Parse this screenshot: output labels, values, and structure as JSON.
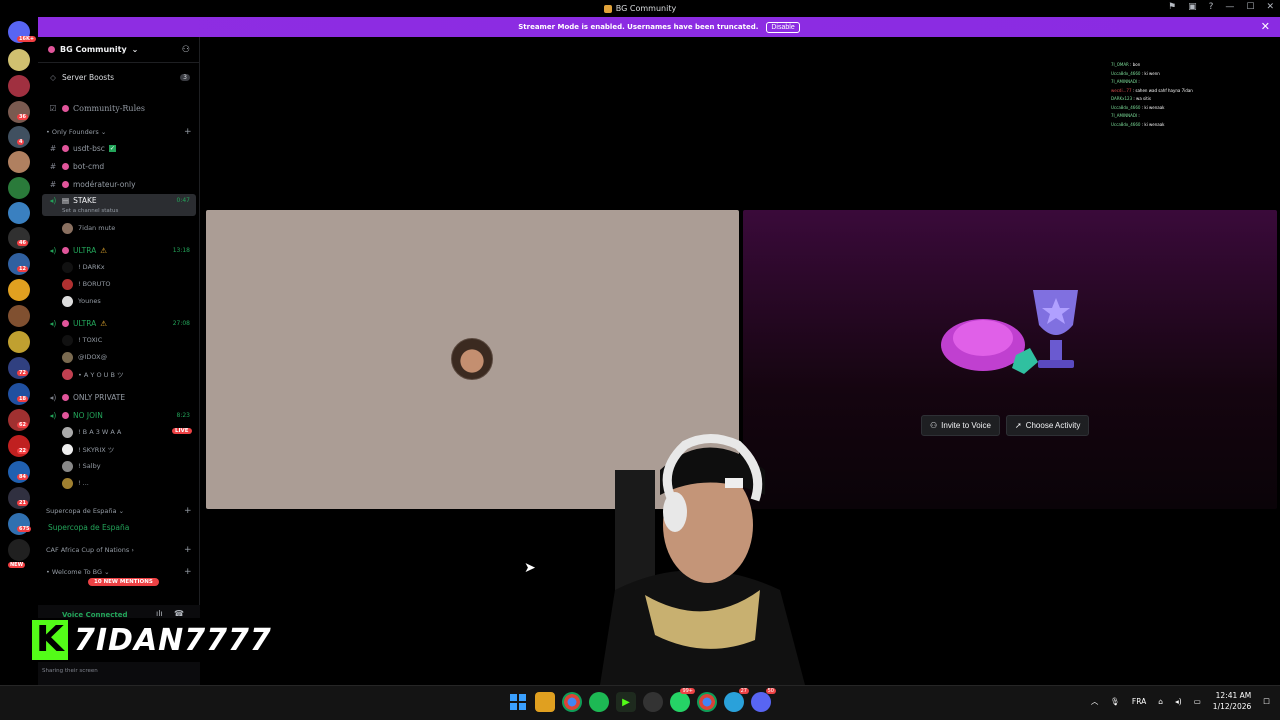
{
  "window": {
    "title": "BG Community"
  },
  "banner": {
    "text": "Streamer Mode is enabled. Usernames have been truncated.",
    "button": "Disable"
  },
  "rail": {
    "badges": [
      "16K+",
      "36",
      "4",
      "46",
      "12",
      "18",
      "72",
      "18",
      "62",
      "22",
      "84",
      "21",
      "675",
      "NEW"
    ]
  },
  "sidebar": {
    "server_name": "BG Community",
    "server_boosts": {
      "label": "Server Boosts",
      "count": "3"
    },
    "community_rules": "Community-Rules",
    "cat_only_founders": "• Only Founders",
    "channels": [
      {
        "label": "usdt-bsc"
      },
      {
        "label": "bot-cmd"
      },
      {
        "label": "modérateur-only"
      }
    ],
    "stake": {
      "label": "STAKE",
      "time": "0:47",
      "status": "Set a channel status"
    },
    "stake_user": "7idan mute",
    "ultra1": {
      "label": "ULTRA",
      "time": "13:18"
    },
    "ultra1_users": [
      "! DARKx",
      "! BORUTO",
      "Younes"
    ],
    "ultra2": {
      "label": "ULTRA",
      "time": "27:08"
    },
    "ultra2_users": [
      "! TOXIC",
      "@IDOX@",
      "• A Y O U B ツ"
    ],
    "only_private": "ONLY PRIVATE",
    "no_join": {
      "label": "NO JOIN",
      "time": "8:23"
    },
    "no_join_users": [
      "! B A 3 W A A",
      "! SKYRIX ツ",
      "! Salby",
      "! ..."
    ],
    "live": "LIVE",
    "cat_supercopa": "Supercopa de España",
    "supercopa_channel": "Supercopa de España",
    "cat_caf": "CAF Africa Cup of Nations",
    "cat_welcome": "• Welcome To BG",
    "new_mentions": "10 NEW MENTIONS",
    "voice_connected": "Voice Connected",
    "sharing": "Sharing their screen"
  },
  "overlay": {
    "k": "K",
    "name": "7IDAN7777"
  },
  "chat": [
    {
      "u": "7I_OMAR",
      "m": "bon"
    },
    {
      "u": "Ucca8dx_4660",
      "m": "ki wenn"
    },
    {
      "u": "7I_AMINNADI",
      "m": ""
    },
    {
      "u": "wecdi...77",
      "m": "sahen wad sahf hayna 7idan"
    },
    {
      "u": "DARKx123",
      "m": "wa sitis"
    },
    {
      "u": "Ucca8dx_4660",
      "m": "ki wenaak"
    },
    {
      "u": "7I_AMINNADI",
      "m": ""
    },
    {
      "u": "Ucca8dx_4660",
      "m": "ki wenaak"
    }
  ],
  "activity": {
    "invite": "Invite to Voice",
    "choose": "Choose Activity"
  },
  "taskbar": {
    "lang": "FRA",
    "time": "12:41 AM",
    "date": "1/12/2026",
    "badge_chat": "99+",
    "badge_tg": "27",
    "badge_dc": "50"
  }
}
